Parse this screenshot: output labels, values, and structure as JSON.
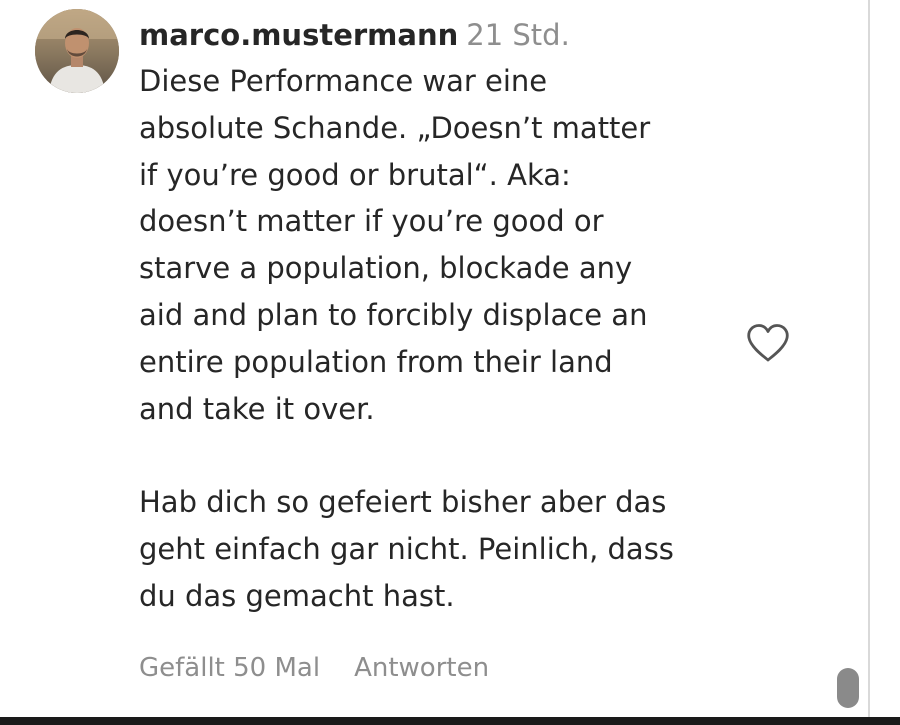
{
  "comment": {
    "username": "marco.mustermann",
    "timestamp": "21 Std.",
    "text_lines": [
      "Diese Performance war eine",
      "absolute Schande. „Doesn’t matter",
      "if you’re good or brutal“. Aka:",
      "doesn’t matter if you’re good or",
      "starve a population, blockade any",
      "aid and plan to forcibly displace an",
      "entire population from their land",
      "and take it over.",
      "",
      "Hab dich so gefeiert bisher aber das",
      "geht einfach gar nicht. Peinlich, dass",
      "du das gemacht hast."
    ],
    "likes_label": "Gefällt 50 Mal",
    "reply_label": "Antworten",
    "like_icon": "heart-outline-icon"
  },
  "colors": {
    "text": "#262626",
    "muted": "#8e8e8e",
    "scrollbar_thumb": "#8a8a8a"
  }
}
